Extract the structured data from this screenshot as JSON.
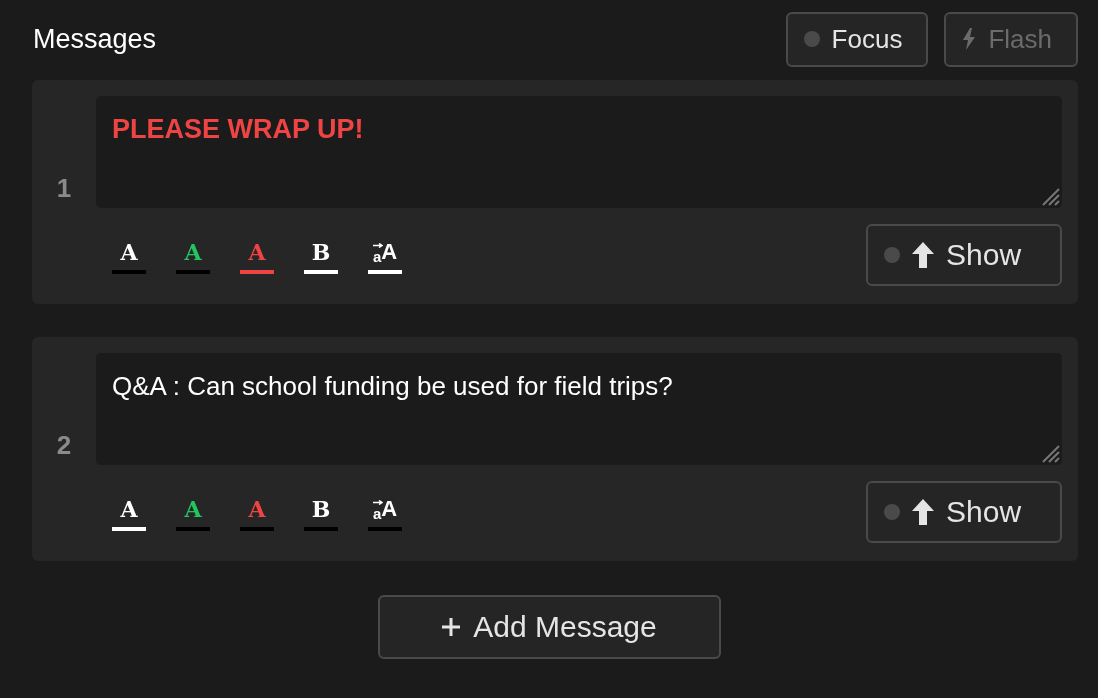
{
  "header": {
    "title": "Messages",
    "focus": {
      "label": "Focus",
      "on": false
    },
    "flash": {
      "label": "Flash",
      "disabled": true
    }
  },
  "messages": [
    {
      "number": "1",
      "text": "PLEASE WRAP UP!",
      "formats": [
        {
          "kind": "white",
          "label": "A",
          "selected": false
        },
        {
          "kind": "green",
          "label": "A",
          "selected": false
        },
        {
          "kind": "red",
          "label": "A",
          "selected": true
        },
        {
          "kind": "bold",
          "label": "B",
          "selected": true
        },
        {
          "kind": "size",
          "label": "aA",
          "selected": true
        }
      ],
      "show": {
        "label": "Show",
        "on": false
      }
    },
    {
      "number": "2",
      "text": "Q&A : Can school funding be used for field trips?",
      "formats": [
        {
          "kind": "white",
          "label": "A",
          "selected": true
        },
        {
          "kind": "green",
          "label": "A",
          "selected": false
        },
        {
          "kind": "red",
          "label": "A",
          "selected": false
        },
        {
          "kind": "bold",
          "label": "B",
          "selected": false
        },
        {
          "kind": "size",
          "label": "aA",
          "selected": false
        }
      ],
      "show": {
        "label": "Show",
        "on": false
      }
    }
  ],
  "add_button": {
    "label": "Add Message"
  }
}
